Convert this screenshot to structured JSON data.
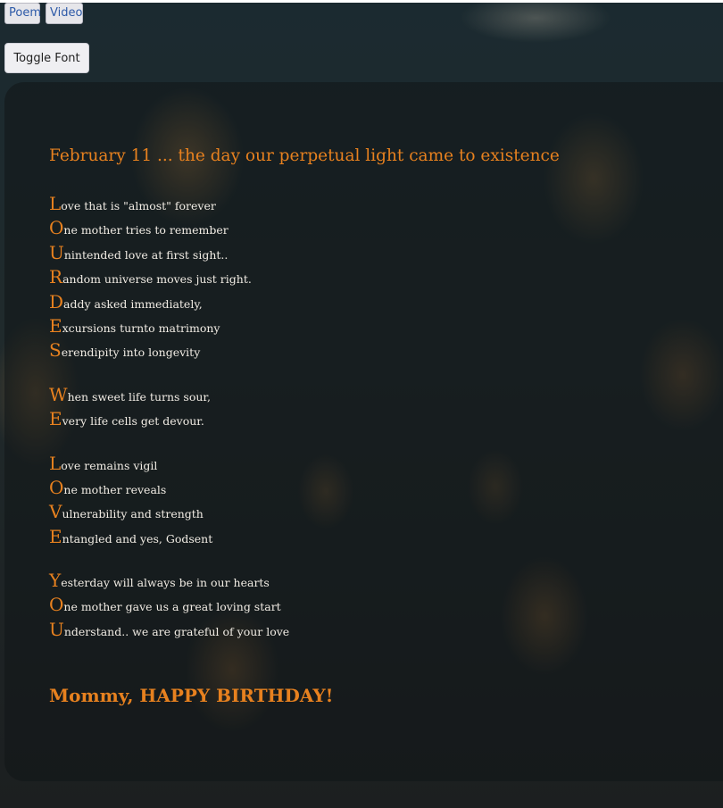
{
  "nav": {
    "poem_label": "Poem",
    "video_label": "Video"
  },
  "controls": {
    "toggle_font_label": "Toggle Font"
  },
  "poem": {
    "heading": "February 11 ... the day our perpetual light came to existence",
    "stanzas": [
      [
        {
          "initial": "L",
          "rest": "ove that is \"almost\" forever"
        },
        {
          "initial": "O",
          "rest": "ne mother tries to remember"
        },
        {
          "initial": "U",
          "rest": "nintended love at first sight.."
        },
        {
          "initial": "R",
          "rest": "andom universe moves just right."
        },
        {
          "initial": "D",
          "rest": "addy asked immediately,"
        },
        {
          "initial": "E",
          "rest": "xcursions turnto matrimony"
        },
        {
          "initial": "S",
          "rest": "erendipity into longevity"
        }
      ],
      [
        {
          "initial": "W",
          "rest": "hen sweet life turns sour,"
        },
        {
          "initial": "E",
          "rest": "very life cells get devour."
        }
      ],
      [
        {
          "initial": "L",
          "rest": "ove remains vigil"
        },
        {
          "initial": "O",
          "rest": "ne mother reveals"
        },
        {
          "initial": "V",
          "rest": "ulnerability and strength"
        },
        {
          "initial": "E",
          "rest": "ntangled and yes, Godsent"
        }
      ],
      [
        {
          "initial": "Y",
          "rest": "esterday will always be in our hearts"
        },
        {
          "initial": "O",
          "rest": "ne mother gave us a great loving start"
        },
        {
          "initial": "U",
          "rest": "nderstand.. we are grateful of your love"
        }
      ]
    ],
    "closing": "Mommy, HAPPY BIRTHDAY!"
  },
  "colors": {
    "accent": "#e7811f",
    "text": "#f1ece4",
    "button_text": "#2d5aa8"
  }
}
